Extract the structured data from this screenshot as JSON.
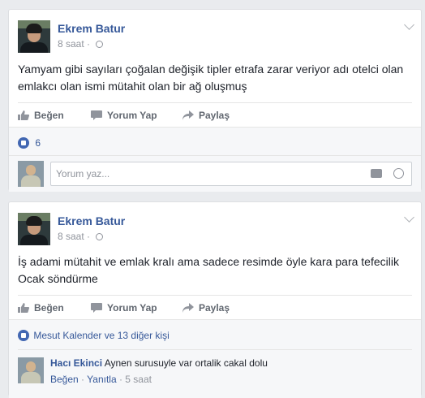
{
  "actions": {
    "like": "Beğen",
    "comment": "Yorum Yap",
    "share": "Paylaş"
  },
  "colors": {
    "link": "#365899",
    "background": "#e9ebee",
    "like_badge": "#4267b2"
  },
  "posts": [
    {
      "author": "Ekrem Batur",
      "time": "8 saat",
      "text": "Yamyam gibi sayıları çoğalan değişik tipler etrafa zarar veriyor adı otelci olan emlakcı olan ismi mütahit olan bir ağ oluşmuş",
      "like_count": "6",
      "comment_placeholder": "Yorum yaz..."
    },
    {
      "author": "Ekrem Batur",
      "time": "8 saat",
      "text": "İş adami mütahit ve emlak kralı ama sadece resimde öyle kara para tefecilik Ocak söndürme",
      "likes_summary": "Mesut Kalender ve 13 diğer kişi",
      "comment": {
        "author": "Hacı Ekinci",
        "text": "Aynen surusuyle var ortalik cakal dolu",
        "like_label": "Beğen",
        "reply_label": "Yanıtla",
        "time": "5 saat"
      }
    }
  ]
}
